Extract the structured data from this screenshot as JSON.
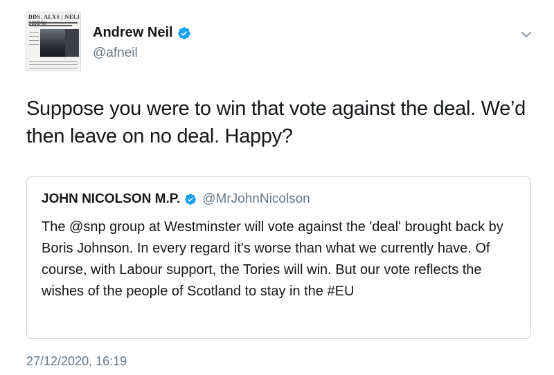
{
  "author": {
    "name": "Andrew Neil",
    "handle": "@afneil",
    "avatar_headline": "DDS. ALXS | NELI SHOW"
  },
  "tweet": {
    "text": "Suppose you were to win that vote against the deal. We’d then leave on no deal. Happy?",
    "timestamp": "27/12/2020, 16:19"
  },
  "quoted_tweet": {
    "name": "JOHN NICOLSON M.P.",
    "handle": "@MrJohnNicolson",
    "text": "The @snp group at Westminster will vote against the 'deal' brought back by Boris Johnson. In every regard it's worse than what we currently have. Of course, with Labour support, the Tories will win. But our vote reflects the wishes of the people of Scotland to stay in the #EU"
  },
  "icons": {
    "verified": "verified-badge-icon",
    "menu": "chevron-down-icon"
  },
  "colors": {
    "verified_blue": "#1da1f2",
    "secondary_text": "#657786",
    "border": "#ccd6dd"
  }
}
